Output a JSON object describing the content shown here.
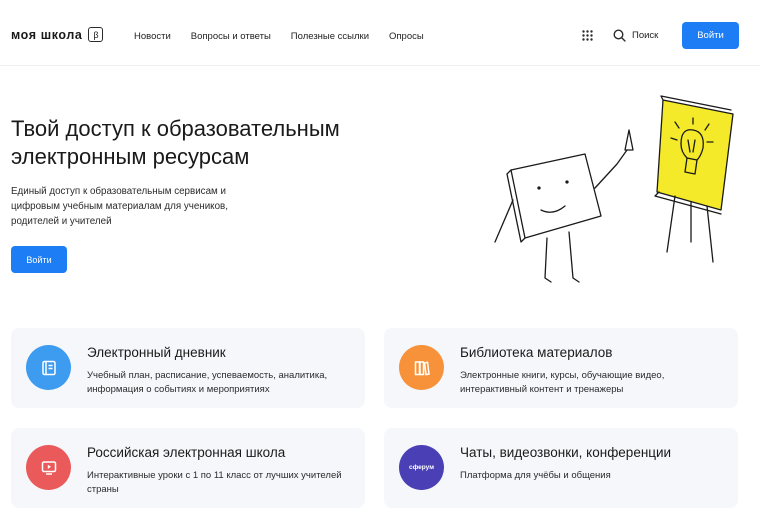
{
  "header": {
    "logo": "моя школа",
    "beta": "β",
    "nav": [
      "Новости",
      "Вопросы и ответы",
      "Полезные ссылки",
      "Опросы"
    ],
    "search_label": "Поиск",
    "login": "Войти"
  },
  "hero": {
    "title": "Твой доступ к образовательным электронным ресурсам",
    "subtitle": "Единый доступ к образовательным сервисам и цифровым учебным материалам для учеников, родителей и учителей",
    "login": "Войти"
  },
  "cards": [
    {
      "title": "Электронный дневник",
      "desc": "Учебный план, расписание, успеваемость, аналитика, информация о событиях и мероприятиях",
      "icon": "diary-icon",
      "color": "#3d9cf0"
    },
    {
      "title": "Библиотека материалов",
      "desc": "Электронные книги, курсы, обучающие видео, интерактивный контент и тренажеры",
      "icon": "books-icon",
      "color": "#f7923a"
    },
    {
      "title": "Российская электронная школа",
      "desc": "Интерактивные уроки с 1 по 11 класс от лучших учителей страны",
      "icon": "play-screen-icon",
      "color": "#ea5a5a"
    },
    {
      "title": "Чаты, видеозвонки, конференции",
      "desc": "Платформа для учёбы и общения",
      "icon": "sferum-icon",
      "icon_text": "сферум",
      "color": "#4a3fb5"
    }
  ],
  "colors": {
    "accent": "#1c7df5",
    "card_bg": "#f5f7fb",
    "illustration_yellow": "#f4ea2a"
  }
}
